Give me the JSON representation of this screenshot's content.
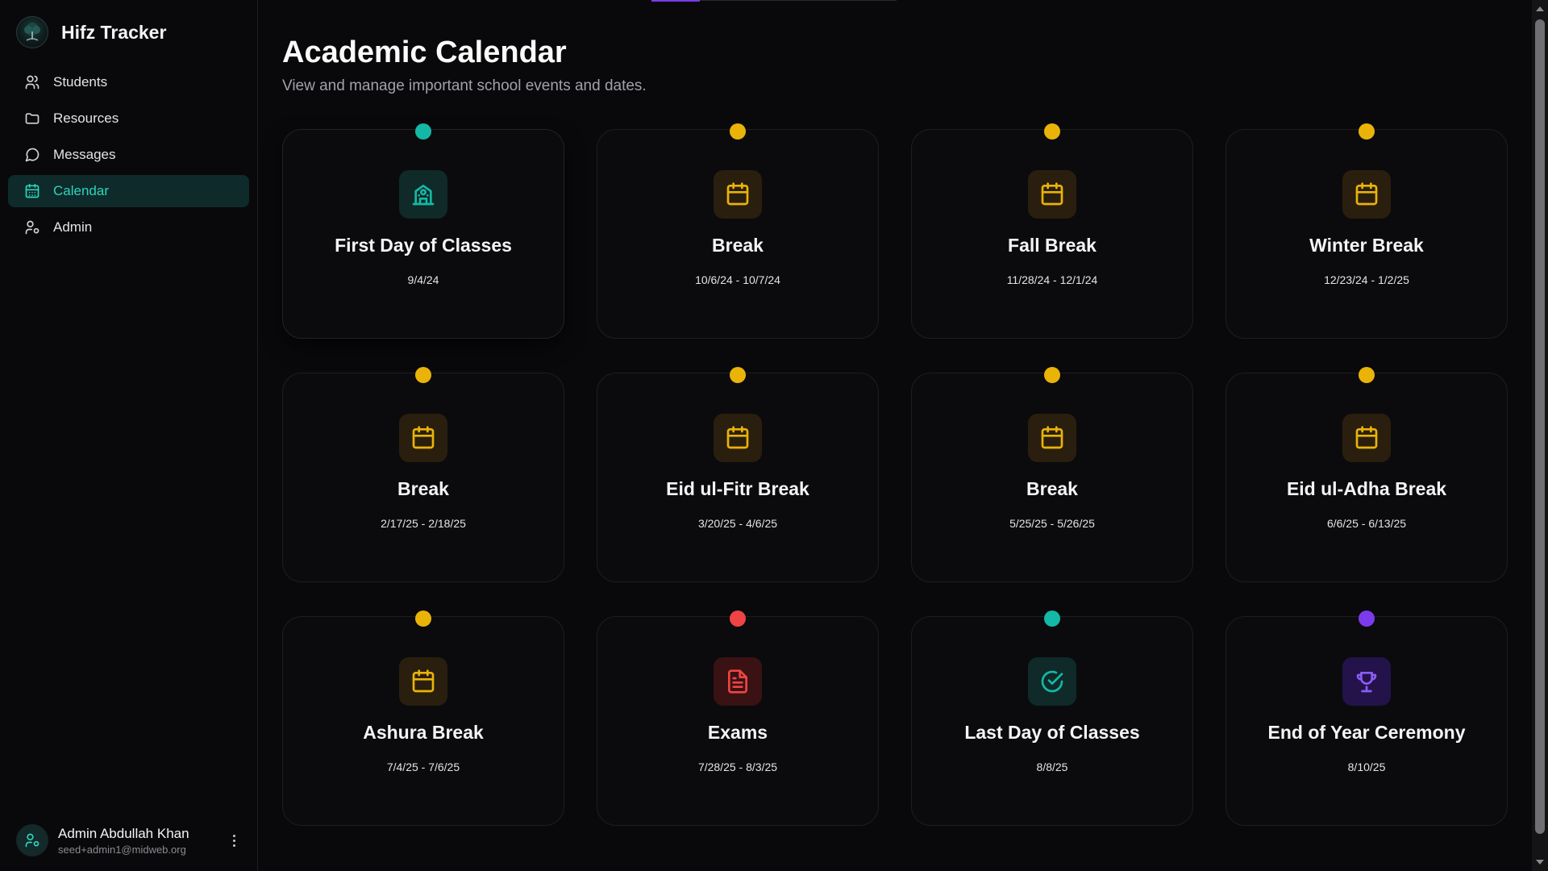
{
  "app": {
    "title": "Hifz Tracker"
  },
  "sidebar": {
    "items": [
      {
        "label": "Students",
        "icon": "users-icon",
        "active": false
      },
      {
        "label": "Resources",
        "icon": "folder-icon",
        "active": false
      },
      {
        "label": "Messages",
        "icon": "message-icon",
        "active": false
      },
      {
        "label": "Calendar",
        "icon": "calendar-icon",
        "active": true
      },
      {
        "label": "Admin",
        "icon": "user-cog-icon",
        "active": false
      }
    ]
  },
  "user": {
    "name": "Admin Abdullah Khan",
    "email": "seed+admin1@midweb.org"
  },
  "page": {
    "title": "Academic Calendar",
    "subtitle": "View and manage important school events and dates."
  },
  "colors": {
    "teal": "#14b8a6",
    "amber": "#eab308",
    "red": "#ef4444",
    "purple": "#7c3aed",
    "active_bg": "#0f2a2a",
    "background": "#09090b"
  },
  "events": [
    {
      "title": "First Day of Classes",
      "date": "9/4/24",
      "type": "school",
      "icon": "school-icon"
    },
    {
      "title": "Break",
      "date": "10/6/24 - 10/7/24",
      "type": "break",
      "icon": "calendar-icon"
    },
    {
      "title": "Fall Break",
      "date": "11/28/24 - 12/1/24",
      "type": "break",
      "icon": "calendar-icon"
    },
    {
      "title": "Winter Break",
      "date": "12/23/24 - 1/2/25",
      "type": "break",
      "icon": "calendar-icon"
    },
    {
      "title": "Break",
      "date": "2/17/25 - 2/18/25",
      "type": "break",
      "icon": "calendar-icon"
    },
    {
      "title": "Eid ul-Fitr Break",
      "date": "3/20/25 - 4/6/25",
      "type": "break",
      "icon": "calendar-icon"
    },
    {
      "title": "Break",
      "date": "5/25/25 - 5/26/25",
      "type": "break",
      "icon": "calendar-icon"
    },
    {
      "title": "Eid ul-Adha Break",
      "date": "6/6/25 - 6/13/25",
      "type": "break",
      "icon": "calendar-icon"
    },
    {
      "title": "Ashura Break",
      "date": "7/4/25 - 7/6/25",
      "type": "break",
      "icon": "calendar-icon"
    },
    {
      "title": "Exams",
      "date": "7/28/25 - 8/3/25",
      "type": "exam",
      "icon": "document-icon"
    },
    {
      "title": "Last Day of Classes",
      "date": "8/8/25",
      "type": "school",
      "icon": "check-circle-icon"
    },
    {
      "title": "End of Year Ceremony",
      "date": "8/10/25",
      "type": "ceremony",
      "icon": "trophy-icon"
    }
  ]
}
